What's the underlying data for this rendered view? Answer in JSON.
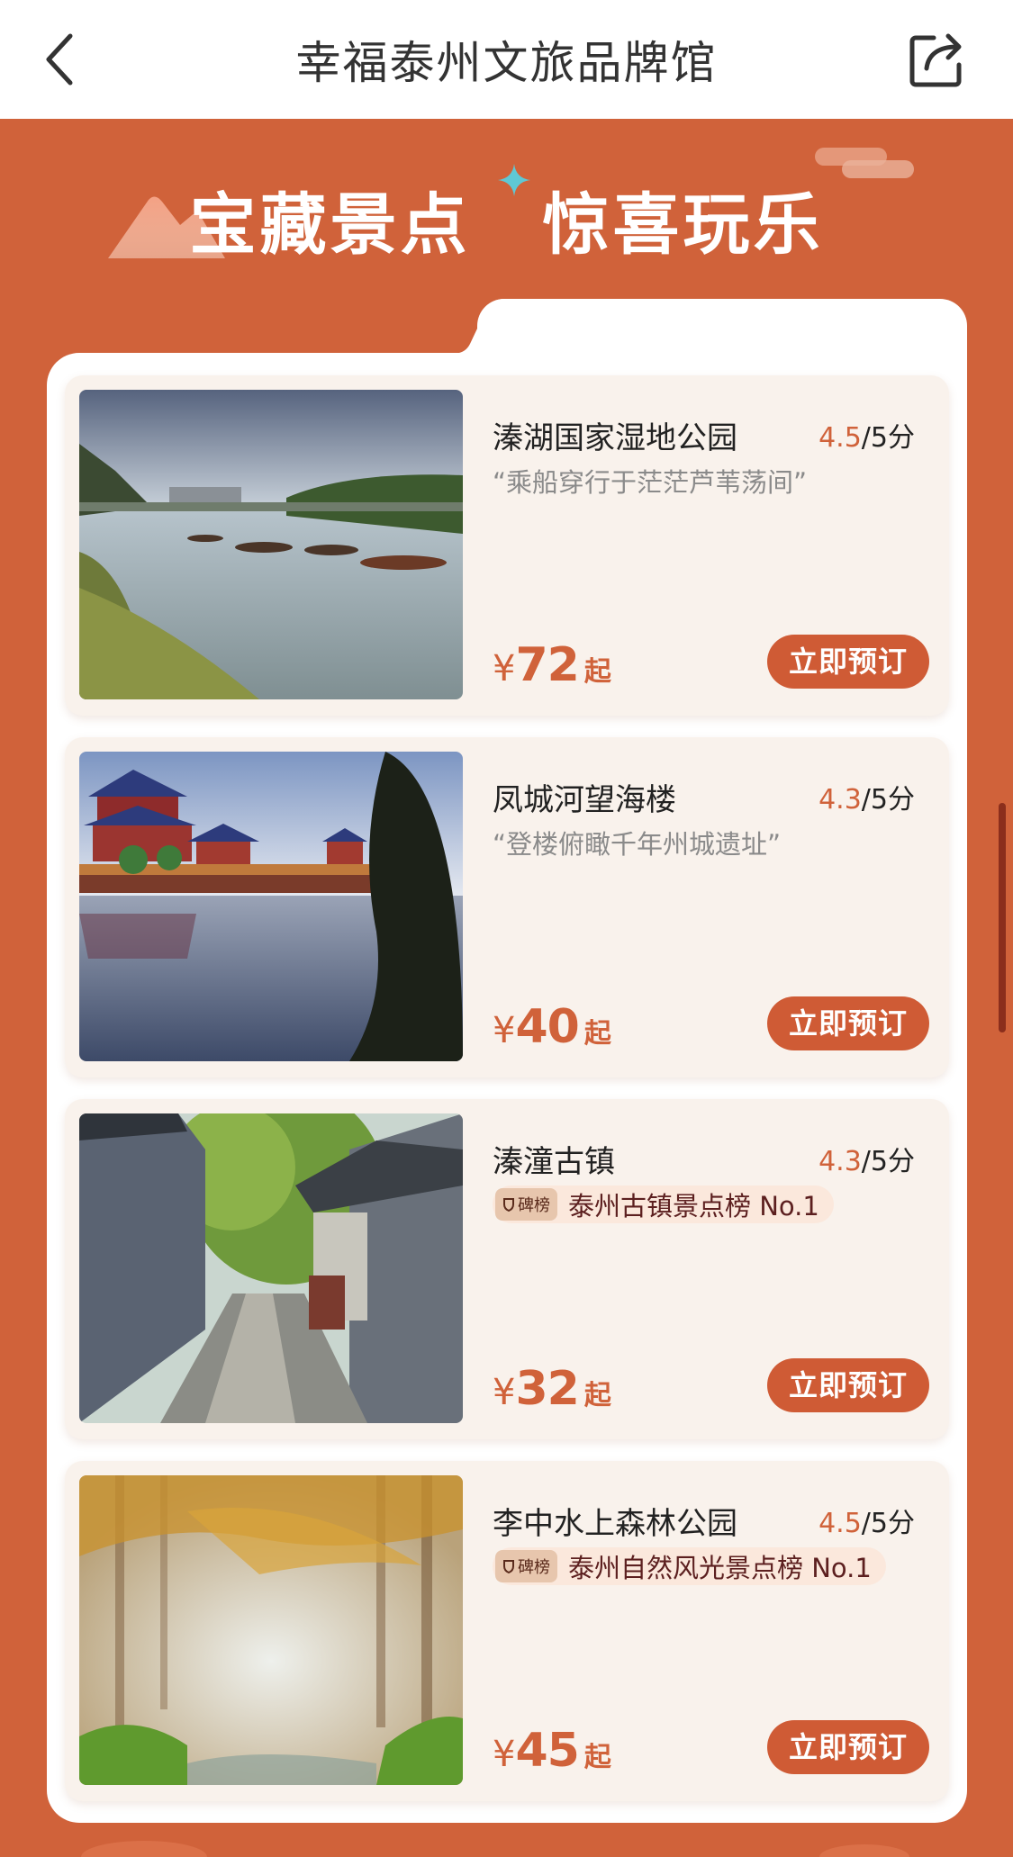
{
  "navbar": {
    "title": "幸福泰州文旅品牌馆",
    "back_icon": "chevron-left-icon",
    "share_icon": "share-icon"
  },
  "banner": {
    "left": "宝藏景点",
    "right": "惊喜玩乐"
  },
  "colors": {
    "accent": "#d0623a",
    "button": "#cf5b35",
    "card_bg": "#f9f2ec"
  },
  "attractions": [
    {
      "name": "溱湖国家湿地公园",
      "score": "4.5",
      "scale": "/5分",
      "quote": "“乘船穿行于茫茫芦苇荡间”",
      "yen": "¥",
      "price": "72",
      "from": "起",
      "button": "立即预订"
    },
    {
      "name": "凤城河望海楼",
      "score": "4.3",
      "scale": "/5分",
      "quote": "“登楼俯瞰千年州城遗址”",
      "yen": "¥",
      "price": "40",
      "from": "起",
      "button": "立即预订"
    },
    {
      "name": "溱潼古镇",
      "score": "4.3",
      "scale": "/5分",
      "badge": "碑榜",
      "rank": "泰州古镇景点榜 No.1",
      "yen": "¥",
      "price": "32",
      "from": "起",
      "button": "立即预订"
    },
    {
      "name": "李中水上森林公园",
      "score": "4.5",
      "scale": "/5分",
      "badge": "碑榜",
      "rank": "泰州自然风光景点榜 No.1",
      "yen": "¥",
      "price": "45",
      "from": "起",
      "button": "立即预订"
    }
  ]
}
